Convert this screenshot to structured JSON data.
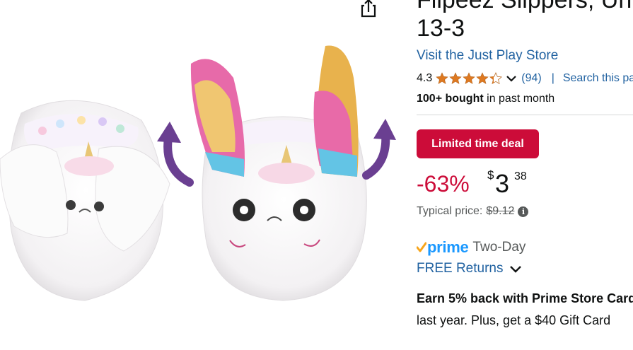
{
  "product": {
    "title_line1": "Flipeez Slippers, Unicorn",
    "title_line2": "13-3",
    "store_link": "Visit the Just Play Store",
    "rating_value": "4.3",
    "rating_stars": 4.3,
    "rating_count": "(94)",
    "separator": "|",
    "search_link": "Search this page",
    "bought_bold": "100+ bought",
    "bought_rest": " in past month"
  },
  "deal": {
    "badge": "Limited time deal",
    "discount": "-63%",
    "currency": "$",
    "price_whole": "3",
    "price_fraction": "38",
    "typical_label": "Typical price:",
    "typical_price": "$9.12",
    "info_icon": "i"
  },
  "shipping": {
    "prime_check": "✓",
    "prime_word": "prime",
    "two_day": "Two-Day",
    "free_returns": "FREE Returns"
  },
  "promo": {
    "earn": "Earn 5% back with Prime Store Card",
    "last_year": "last year. Plus, get a $40 Gift Card"
  },
  "icons": [
    "share-icon",
    "star-icon",
    "chevron-down-icon",
    "info-icon",
    "prime-check-icon"
  ],
  "colors": {
    "link": "#2162a1",
    "deal": "#cc0c39",
    "star": "#de7921",
    "prime": "#1a98ff",
    "text": "#0f1111",
    "muted": "#565959"
  }
}
